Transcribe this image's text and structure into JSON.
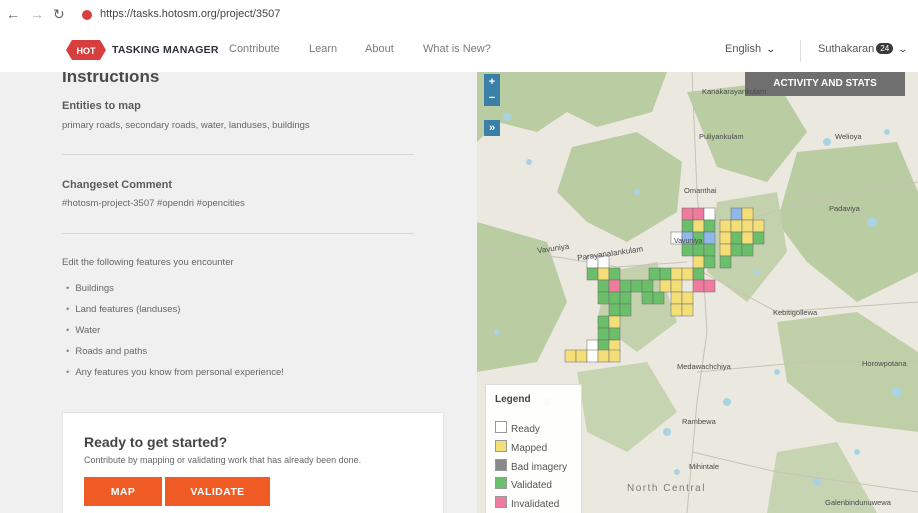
{
  "browser": {
    "url": "https://tasks.hotosm.org/project/3507"
  },
  "header": {
    "logo_badge": "HOT",
    "logo_text": "TASKING MANAGER",
    "menu": [
      "Contribute",
      "Learn",
      "About",
      "What is New?"
    ],
    "language": "English",
    "user_name": "Suthakaran",
    "user_badge": "24"
  },
  "instructions": {
    "heading": "Instructions",
    "entities_title": "Entities to map",
    "entities_body": "primary roads, secondary roads, water, landuses, buildings",
    "changeset_title": "Changeset Comment",
    "changeset_body": "#hotosm-project-3507 #opendri #opencities",
    "edit_intro": "Edit the following features you encounter",
    "features": [
      "Buildings",
      "Land features (landuses)",
      "Water",
      "Roads and paths",
      "Any features you know from personal experience!"
    ]
  },
  "card": {
    "title": "Ready to get started?",
    "subtitle": "Contribute by mapping or validating work that has already been done.",
    "map_button": "MAP",
    "validate_button": "VALIDATE"
  },
  "map": {
    "zoom_in": "+",
    "zoom_out": "−",
    "expand": "»",
    "activity_button": "ACTIVITY AND STATS",
    "places": [
      "Kanakarayankulam",
      "Puliyankulam",
      "Welioya",
      "Omanthai",
      "Padaviya",
      "Vavuniya",
      "Parayanalankulam",
      "Kebitigollewa",
      "Medawachchiya",
      "Horowpotana",
      "Rambewa",
      "Mihintale",
      "North Central",
      "Galenbindunuwewa",
      "Vavuniya"
    ],
    "legend": {
      "title": "Legend",
      "items": [
        {
          "label": "Ready",
          "color": "#ffffff"
        },
        {
          "label": "Mapped",
          "color": "#f4de78"
        },
        {
          "label": "Bad imagery",
          "color": "#8a8a8a"
        },
        {
          "label": "Validated",
          "color": "#6bbf6b"
        },
        {
          "label": "Invalidated",
          "color": "#ef7c9f"
        }
      ]
    }
  },
  "colors": {
    "accent": "#f05a24",
    "water": "#a9d3e3",
    "forest": "#b8cba0",
    "brand": "#d73f3f"
  }
}
